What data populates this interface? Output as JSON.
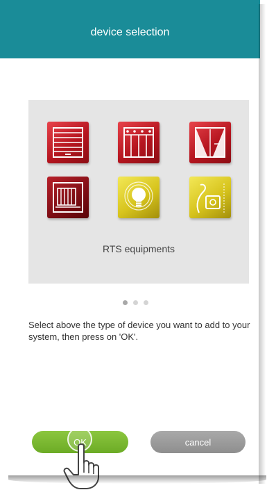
{
  "header": {
    "title": "device selection"
  },
  "carousel": {
    "category_label": "RTS equipments",
    "pages_total": 3,
    "active_page": 1,
    "devices": [
      {
        "icon": "roller-shutter-icon",
        "color": "red"
      },
      {
        "icon": "venetian-blind-icon",
        "color": "red"
      },
      {
        "icon": "curtain-icon",
        "color": "red"
      },
      {
        "icon": "gate-icon",
        "color": "dark-red"
      },
      {
        "icon": "light-bulb-icon",
        "color": "yellow"
      },
      {
        "icon": "plug-socket-icon",
        "color": "yellow"
      }
    ]
  },
  "instructions": "Select above the type of device you want to add to your system, then press on 'OK'.",
  "buttons": {
    "ok_label": "OK",
    "cancel_label": "cancel"
  },
  "colors": {
    "header_bg": "#1a8c98",
    "ok_button": "#7bb833",
    "cancel_button": "#9c9c9c",
    "device_red": "#c41e27",
    "device_yellow": "#e2d230"
  }
}
